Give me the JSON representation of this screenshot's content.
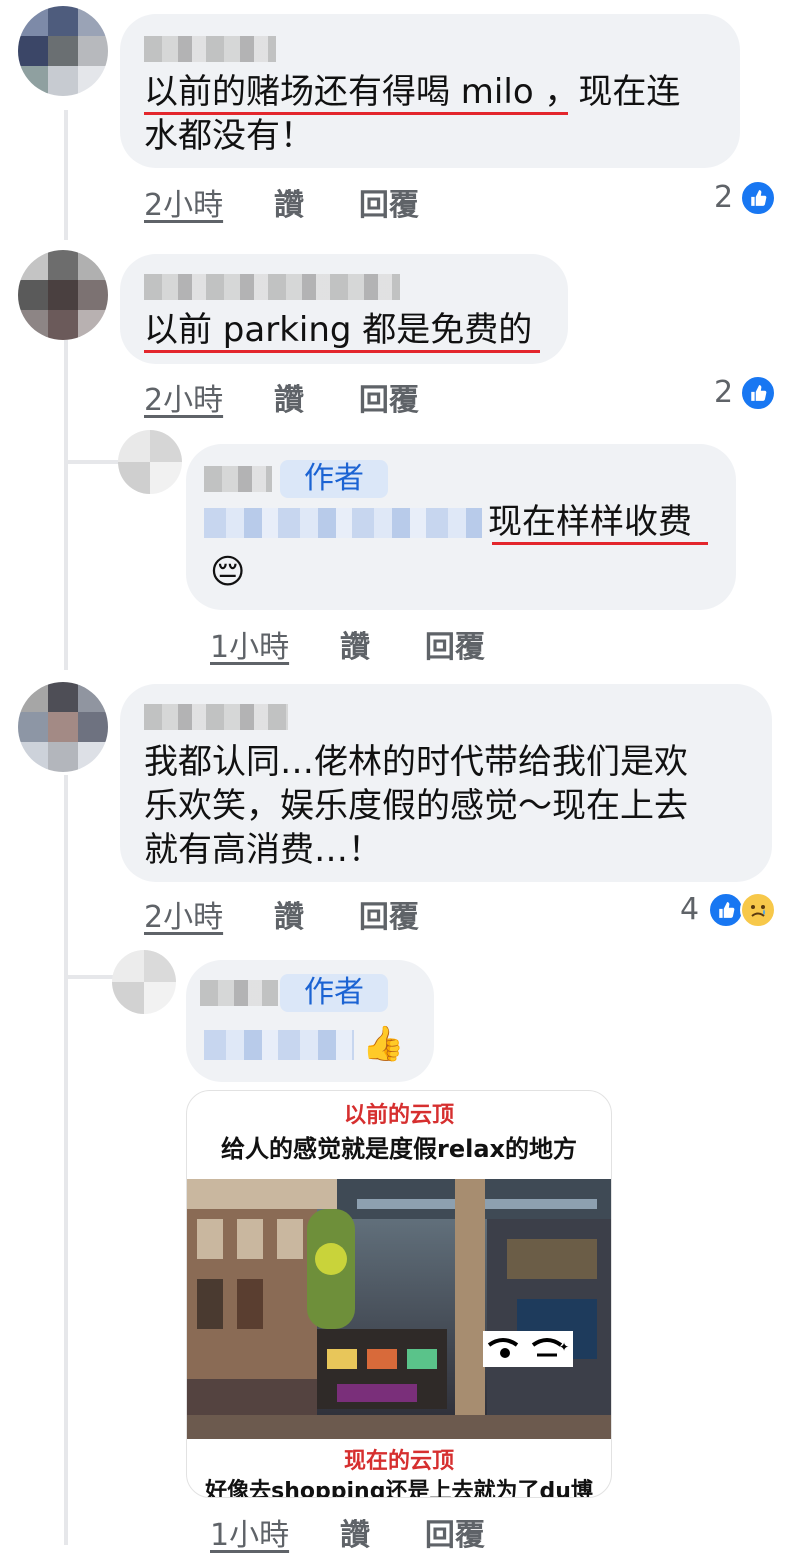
{
  "comments": [
    {
      "text_lines": [
        "以前的赌场还有得喝 milo ，现在连",
        "水都没有！"
      ],
      "time": "2小時",
      "like_label": "讚",
      "reply_label": "回覆",
      "reaction_count": "2",
      "reactions": [
        "like-icon"
      ]
    },
    {
      "text_lines": [
        "以前 parking 都是免费的"
      ],
      "time": "2小時",
      "like_label": "讚",
      "reply_label": "回覆",
      "reaction_count": "2",
      "reactions": [
        "like-icon"
      ]
    },
    {
      "is_reply": true,
      "badge": "作者",
      "text_lines": [
        "现在样样收费"
      ],
      "emoji": "😔",
      "time": "1小時",
      "like_label": "讚",
      "reply_label": "回覆"
    },
    {
      "text_lines": [
        "我都认同…佬林的时代带给我们是欢",
        "乐欢笑，娱乐度假的感觉～现在上去",
        "就有高消费…！"
      ],
      "time": "2小時",
      "like_label": "讚",
      "reply_label": "回覆",
      "reaction_count": "4",
      "reactions": [
        "like-icon",
        "sad-icon"
      ]
    },
    {
      "is_reply": true,
      "badge": "作者",
      "emoji": "👍",
      "time": "1小時",
      "like_label": "讚",
      "reply_label": "回覆",
      "image": {
        "top_red": "以前的云顶",
        "top_black": "给人的感觉就是度假relax的地方",
        "bottom_red": "现在的云顶",
        "bottom_black": "好像去shopping还是上去就为了du博"
      }
    }
  ],
  "colors": {
    "bubble_bg": "#f0f2f5",
    "underline_red": "#e3262c",
    "badge_text": "#1b63d3",
    "like_blue": "#1877f2",
    "meta_gray": "#5f6368"
  }
}
